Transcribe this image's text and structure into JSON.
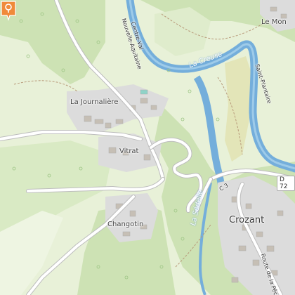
{
  "map": {
    "places": {
      "la_journaliere": "La Journalière",
      "vitrat": "Vitrat",
      "changotin": "Changotin",
      "crozant": "Crozant",
      "le_mon": "Le Mon"
    },
    "rivers": {
      "la_creuse": "La Creuse",
      "la_sedelle": "La Sédelle"
    },
    "trails": {
      "centre_val": "Centre-Val",
      "nouvelle_aquitaine": "Nouvelle-Aquitaine",
      "saint_plantaire": "Saint-Plantaire"
    },
    "roads": {
      "d72": "D 72",
      "c3": "C 3",
      "route_de_la_pech": "Route de la Pêch"
    },
    "icons": {
      "marker": "location-pin-icon",
      "castle": "castle-icon"
    },
    "colors": {
      "forest": "#cfe3b6",
      "meadow": "#e6f1d3",
      "water": "#74aedb",
      "road": "#ffffff",
      "settlement": "#dddddd",
      "marker": "#f08a3a"
    }
  }
}
